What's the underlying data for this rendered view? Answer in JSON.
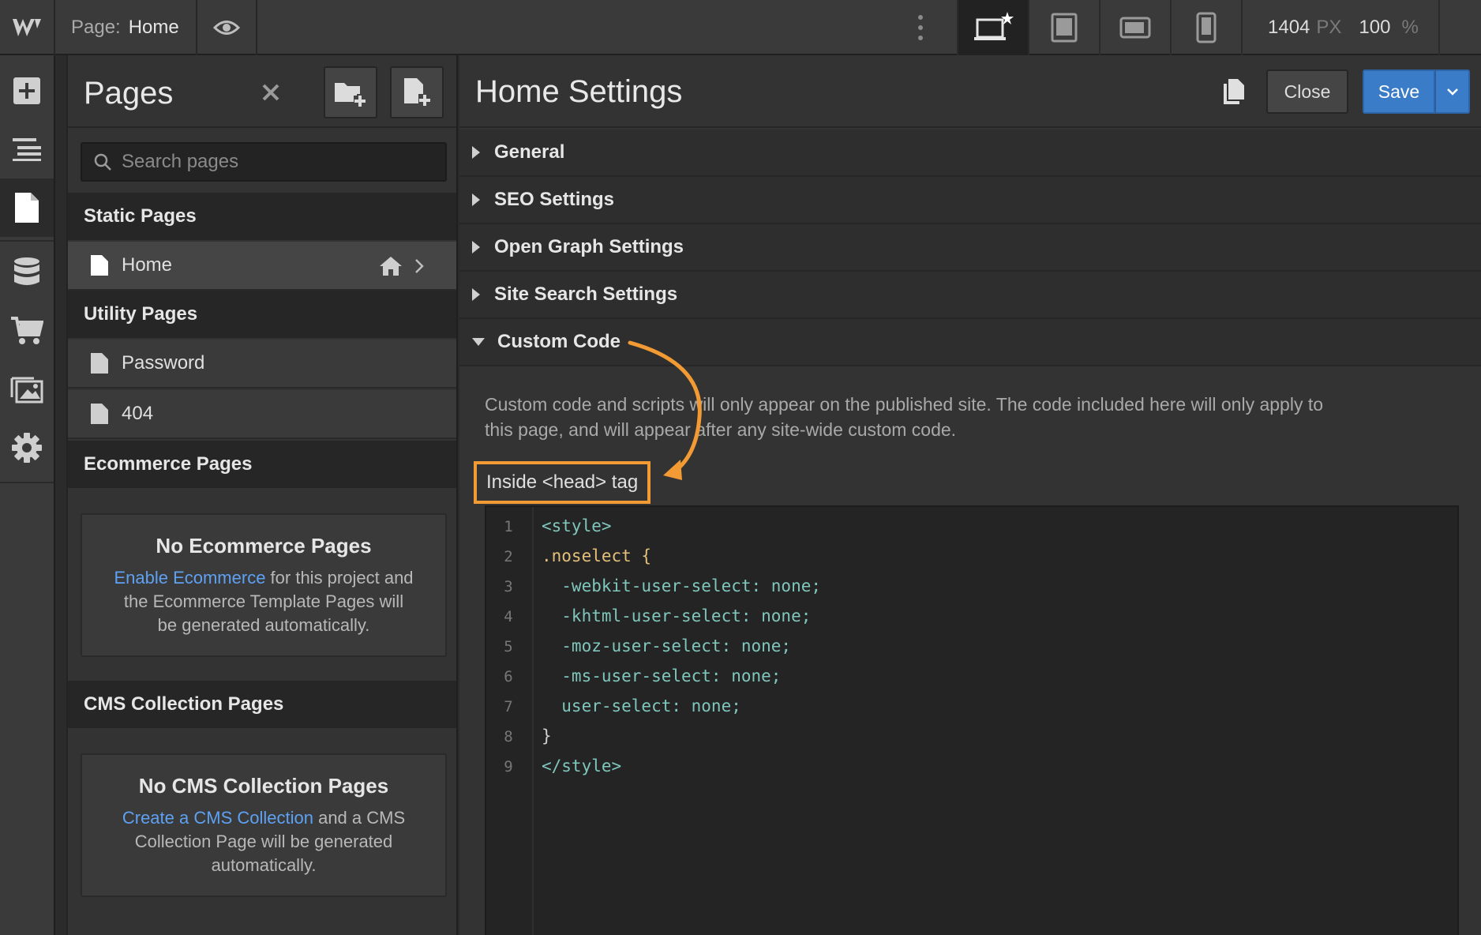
{
  "topbar": {
    "page_label": "Page:",
    "page_name": "Home",
    "width_value": "1404",
    "width_unit": "PX",
    "zoom_value": "100",
    "zoom_unit": "%",
    "devices": [
      "desktop-star-icon",
      "tablet-icon",
      "mobile-landscape-icon",
      "mobile-portrait-icon"
    ]
  },
  "rail": {
    "items": [
      "add-icon",
      "navigator-icon",
      "pages-icon",
      "cms-icon",
      "ecommerce-icon",
      "assets-icon",
      "settings-icon"
    ]
  },
  "pages_panel": {
    "title": "Pages",
    "search_placeholder": "Search pages",
    "static_heading": "Static Pages",
    "static_pages": [
      "Home"
    ],
    "utility_heading": "Utility Pages",
    "utility_pages": [
      "Password",
      "404"
    ],
    "ecommerce_heading": "Ecommerce Pages",
    "ecommerce_empty": {
      "title": "No Ecommerce Pages",
      "link": "Enable Ecommerce",
      "text1": " for this project and",
      "text2": "the Ecommerce Template Pages will",
      "text3": "be generated automatically."
    },
    "cms_heading": "CMS Collection Pages",
    "cms_empty": {
      "title": "No CMS Collection Pages",
      "link": "Create a CMS Collection",
      "text1": " and a CMS",
      "text2": "Collection Page will be generated",
      "text3": "automatically."
    }
  },
  "settings": {
    "title": "Home Settings",
    "close_label": "Close",
    "save_label": "Save",
    "sections": [
      "General",
      "SEO Settings",
      "Open Graph Settings",
      "Site Search Settings",
      "Custom Code"
    ],
    "custom_code_desc_1": "Custom code and scripts will only appear on the published site. The code included here will only apply to",
    "custom_code_desc_2": "this page, and will appear after any site-wide custom code.",
    "head_label": "Inside <head> tag",
    "code_lines": [
      "<style>",
      ".noselect {",
      "  -webkit-user-select: none;",
      "  -khtml-user-select: none;",
      "  -moz-user-select: none;",
      "  -ms-user-select: none;",
      "  user-select: none;",
      "}",
      "</style>"
    ],
    "line_numbers": [
      "1",
      "2",
      "3",
      "4",
      "5",
      "6",
      "7",
      "8",
      "9"
    ]
  },
  "colors": {
    "accent_blue": "#3b7cc9",
    "highlight_orange": "#f29a33",
    "link_blue": "#5ea1f2"
  }
}
